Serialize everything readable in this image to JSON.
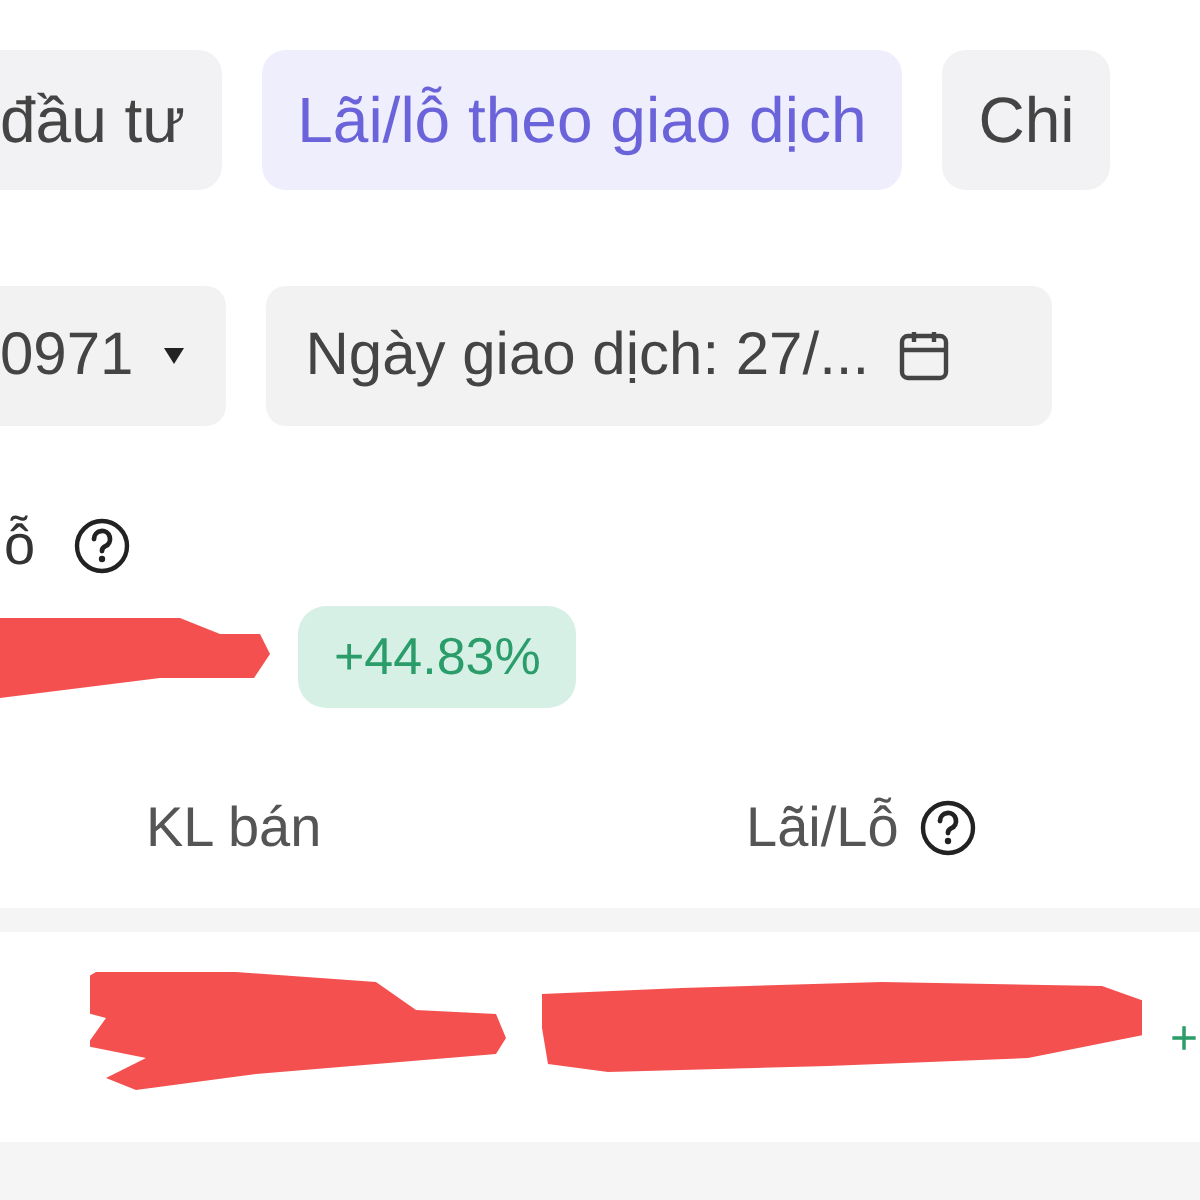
{
  "tabs": [
    {
      "label": "đầu tư",
      "selected": false
    },
    {
      "label": "Lãi/lỗ theo giao dịch",
      "selected": true
    },
    {
      "label": "Chi",
      "selected": false
    }
  ],
  "filters": {
    "account": "0971",
    "date": "Ngày giao dịch: 27/..."
  },
  "summary": {
    "label": "ỗ",
    "change": "+44.83%"
  },
  "table": {
    "columns": [
      "KL bán",
      "Lãi/Lỗ"
    ],
    "rows": [
      {
        "column_3": "+"
      }
    ]
  }
}
